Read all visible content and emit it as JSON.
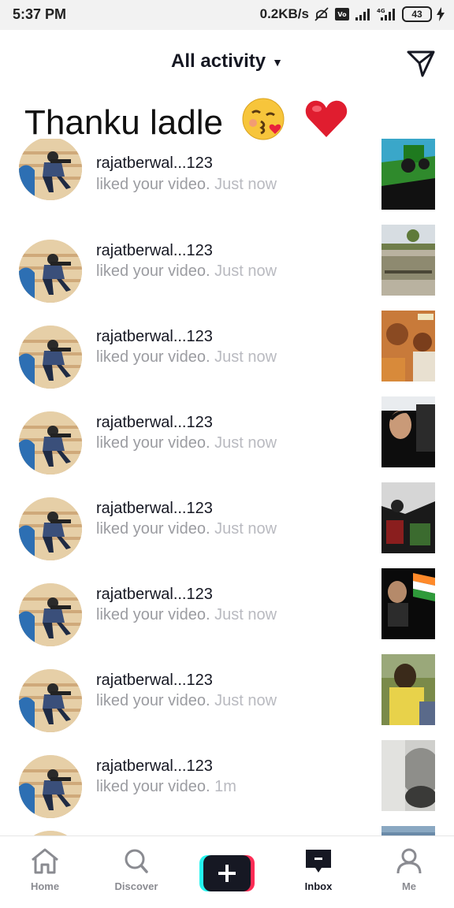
{
  "status_bar": {
    "time": "5:37 PM",
    "speed": "0.2KB/s",
    "icons": [
      "mute-icon",
      "volte-icon",
      "signal-icon",
      "4g-signal-icon",
      "charging-icon"
    ],
    "battery": "43"
  },
  "header": {
    "title": "All activity",
    "caret_icon": "caret-down-icon",
    "send_icon": "direct-message-icon"
  },
  "caption": {
    "text": "Thanku ladle",
    "emojis": [
      "kissing-face-emoji",
      "red-heart-emoji"
    ]
  },
  "notifications": [
    {
      "user": "rajatberwal...123",
      "action": "liked your video.",
      "time": "Just now",
      "thumb_theme": "tractor-dark"
    },
    {
      "user": "rajatberwal...123",
      "action": "liked your video.",
      "time": "Just now",
      "thumb_theme": "field"
    },
    {
      "user": "rajatberwal...123",
      "action": "liked your video.",
      "time": "Just now",
      "thumb_theme": "people-warm"
    },
    {
      "user": "rajatberwal...123",
      "action": "liked your video.",
      "time": "Just now",
      "thumb_theme": "face-dark"
    },
    {
      "user": "rajatberwal...123",
      "action": "liked your video.",
      "time": "Just now",
      "thumb_theme": "crowd-dark"
    },
    {
      "user": "rajatberwal...123",
      "action": "liked your video.",
      "time": "Just now",
      "thumb_theme": "flag-dark"
    },
    {
      "user": "rajatberwal...123",
      "action": "liked your video.",
      "time": "Just now",
      "thumb_theme": "person-yellow"
    },
    {
      "user": "rajatberwal...123",
      "action": "liked your video.",
      "time": "1m",
      "thumb_theme": "grey-blur"
    }
  ],
  "tabbar": {
    "items": [
      {
        "label": "Home",
        "icon": "home-icon",
        "active": false
      },
      {
        "label": "Discover",
        "icon": "search-icon",
        "active": false
      },
      {
        "label": "",
        "icon": "plus-icon",
        "active": false
      },
      {
        "label": "Inbox",
        "icon": "inbox-icon",
        "active": true
      },
      {
        "label": "Me",
        "icon": "profile-icon",
        "active": false
      }
    ]
  },
  "colors": {
    "primary_text": "#161823",
    "secondary_text": "#9b9ca1",
    "create_cyan": "#25f4ee",
    "create_red": "#fe2c55"
  }
}
